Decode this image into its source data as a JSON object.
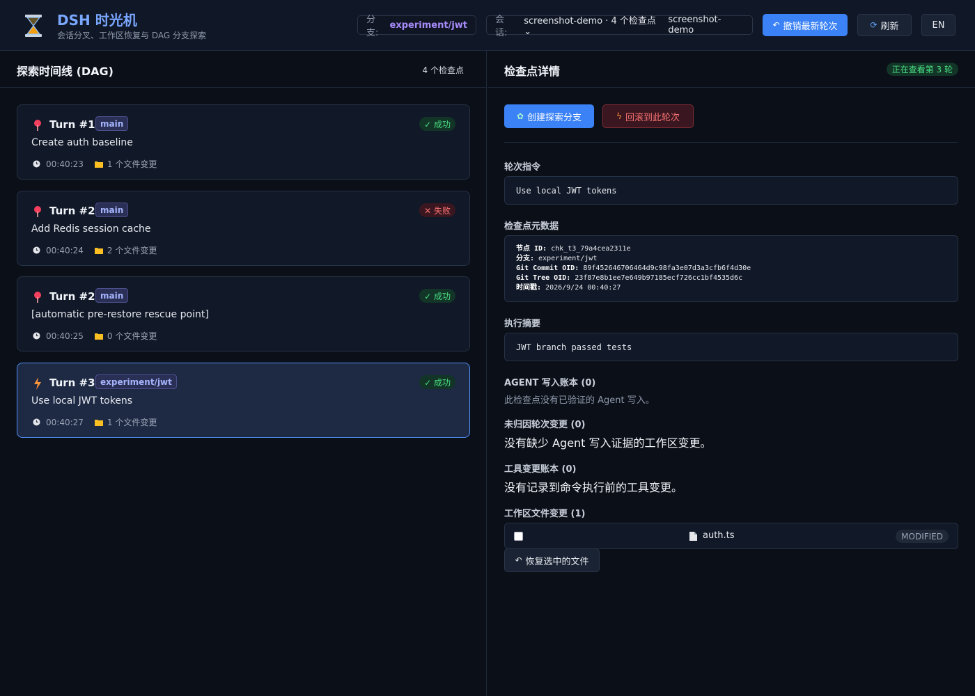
{
  "header": {
    "title": "DSH 时光机",
    "subtitle": "会话分叉、工作区恢复与 DAG 分支探索",
    "branch_key": "分支:",
    "branch_value": "experiment/jwt",
    "session_key": "会话:",
    "session_select": "screenshot-demo · 4 个检查点",
    "session_value": "screenshot-demo",
    "undo_label": "撤销最新轮次",
    "refresh_label": "刷新",
    "lang_label": "EN"
  },
  "timeline": {
    "title": "探索时间线 (DAG)",
    "count": "4 个检查点",
    "cards": [
      {
        "turn": "Turn #1",
        "tag": "main",
        "status": "✓ 成功",
        "desc": "Create auth baseline",
        "time": "00:40:23",
        "files": "1 个文件变更"
      },
      {
        "turn": "Turn #2",
        "tag": "main",
        "status": "✕ 失败",
        "desc": "Add Redis session cache",
        "time": "00:40:24",
        "files": "2 个文件变更"
      },
      {
        "turn": "Turn #2",
        "tag": "main",
        "status": "✓ 成功",
        "desc": "[automatic pre-restore rescue point]",
        "time": "00:40:25",
        "files": "0 个文件变更"
      },
      {
        "turn": "Turn #3",
        "tag": "experiment/jwt",
        "status": "✓ 成功",
        "desc": "Use local JWT tokens",
        "time": "00:40:27",
        "files": "1 个文件变更"
      }
    ]
  },
  "details": {
    "title": "检查点详情",
    "viewing": "正在查看第 3 轮",
    "create_branch": "创建探索分支",
    "restore_turn": "回滚到此轮次",
    "instruction_label": "轮次指令",
    "instruction": "Use local JWT tokens",
    "metadata_label": "检查点元数据",
    "metadata": [
      {
        "k": "节点 ID",
        "v": "chk_t3_79a4cea2311e"
      },
      {
        "k": "分支",
        "v": "experiment/jwt"
      },
      {
        "k": "Git Commit OID",
        "v": "89f452646706464d9c98fa3e07d3a3cfb6f4d30e"
      },
      {
        "k": "Git Tree OID",
        "v": "23f87e8b1ee7e649b97185ecf726cc1bf4535d6c"
      },
      {
        "k": "时间戳",
        "v": "2026/9/24 00:40:27"
      }
    ],
    "summary_label": "执行摘要",
    "summary": "JWT branch passed tests",
    "agent_label": "AGENT 写入账本 (0)",
    "agent_note": "此检查点没有已验证的 Agent 写入。",
    "unattributed_label": "未归因轮次变更 (0)",
    "unattributed_note": "没有缺少 Agent 写入证据的工作区变更。",
    "tool_label": "工具变更账本 (0)",
    "tool_note": "没有记录到命令执行前的工具变更。",
    "files_label": "工作区文件变更 (1)",
    "file_name": "auth.ts",
    "file_status": "MODIFIED",
    "restore_files": "恢复选中的文件"
  },
  "colors": {
    "accent": "#3b82f6",
    "success": "#4ade80",
    "danger": "#f87171",
    "branch": "#a78bfa"
  }
}
